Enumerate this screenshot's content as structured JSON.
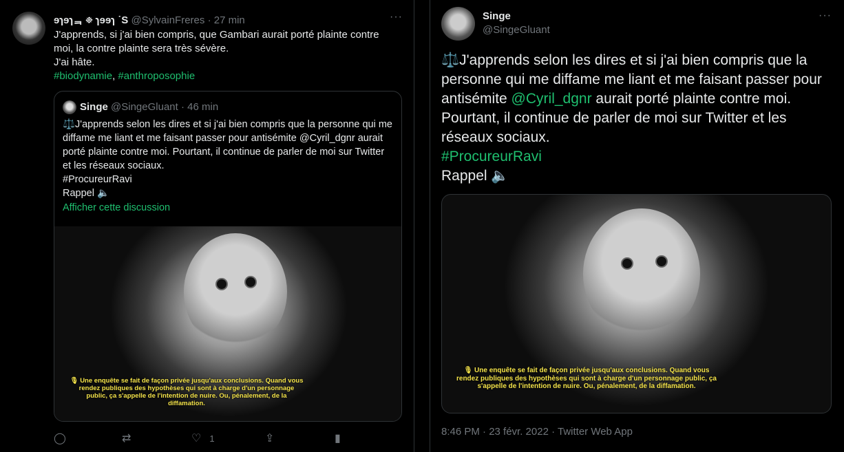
{
  "left_tweet": {
    "display_name": "ɘɿɘɿᆿ ፠ ɿɘɘɿ ˙S",
    "handle": "@SylvainFreres",
    "time": "27 min",
    "more_icon": "···",
    "text_line1": "J'apprends, si j'ai bien compris, que Gambari aurait porté plainte contre moi, la contre plainte sera très sévère.",
    "text_line2": "J'ai hâte.",
    "hashtag1": "#biodynamie",
    "hashtag_sep": ", ",
    "hashtag2": "#anthroposophie",
    "quote": {
      "display_name": "Singe",
      "handle": "@SingeGluant",
      "time": "46 min",
      "line1": "⚖️J'apprends selon les dires et si j'ai bien compris que la personne qui me diffame me liant et me faisant passer pour antisémite @Cyril_dgnr aurait porté plainte contre moi. Pourtant, il continue de parler de moi sur Twitter et les réseaux sociaux.",
      "hashtag": "#ProcureurRavi",
      "rappel": "Rappel 🔈",
      "show_thread": "Afficher cette discussion",
      "caption": "🎙 Une enquête se fait de façon privée jusqu'aux conclusions. Quand vous rendez publiques des hypothèses qui sont à charge d'un personnage public, ça s'appelle de l'intention de nuire. Ou, pénalement, de la diffamation."
    },
    "actions": {
      "reply_icon": "◯",
      "retweet_icon": "⇄",
      "like_icon": "♡",
      "like_count": "1",
      "share_icon": "⇪",
      "analytics_icon": "▮"
    }
  },
  "right_tweet": {
    "display_name": "Singe",
    "handle": "@SingeGluant",
    "more_icon": "···",
    "text_part1": "⚖️J'apprends selon les dires et si j'ai bien compris que la personne qui me diffame me liant et me faisant passer pour antisémite ",
    "mention": "@Cyril_dgnr",
    "text_part2": " aurait porté plainte contre moi. Pourtant, il continue de parler de moi sur Twitter et les réseaux sociaux.",
    "hashtag": "#ProcureurRavi",
    "rappel": "Rappel 🔈",
    "caption": "🎙 Une enquête se fait de façon privée jusqu'aux conclusions. Quand vous rendez publiques des hypothèses qui sont à charge d'un personnage public, ça s'appelle de l'intention de nuire. Ou, pénalement, de la diffamation.",
    "timestamp": "8:46 PM · 23 févr. 2022 · Twitter Web App"
  },
  "colors": {
    "background": "#000000",
    "text": "#e7e9ea",
    "muted": "#71767b",
    "accent": "#1fbf6f",
    "caption": "#f4e34a",
    "border": "#2f3336"
  }
}
